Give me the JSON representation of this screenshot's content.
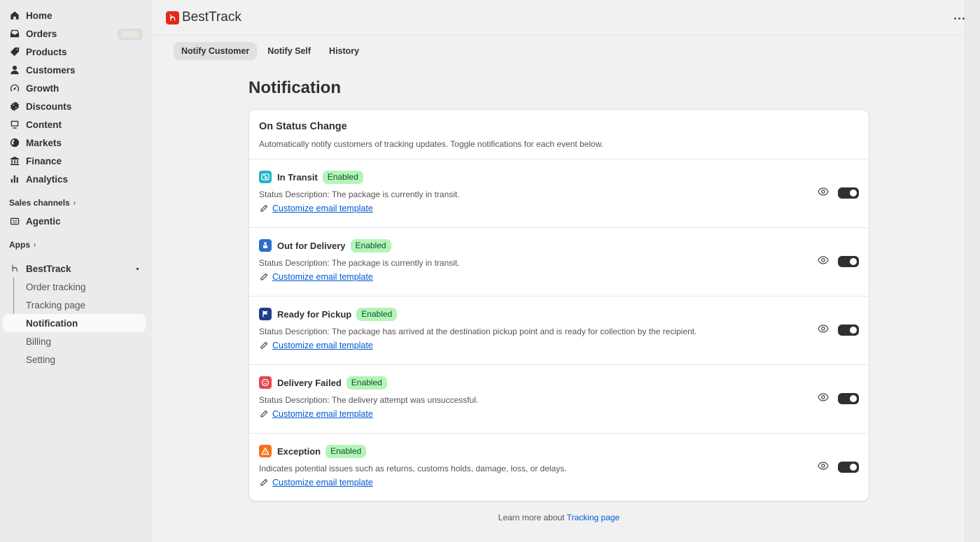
{
  "sidebar": {
    "items": [
      {
        "label": "Home",
        "icon": "home-icon"
      },
      {
        "label": "Orders",
        "icon": "orders-icon"
      },
      {
        "label": "Products",
        "icon": "tag-icon"
      },
      {
        "label": "Customers",
        "icon": "person-icon"
      },
      {
        "label": "Growth",
        "icon": "gauge-icon"
      },
      {
        "label": "Discounts",
        "icon": "discount-icon"
      },
      {
        "label": "Content",
        "icon": "image-icon"
      },
      {
        "label": "Markets",
        "icon": "globe-icon"
      },
      {
        "label": "Finance",
        "icon": "bank-icon"
      },
      {
        "label": "Analytics",
        "icon": "bar-chart-icon"
      }
    ],
    "sales_channels_label": "Sales channels",
    "agentic_label": "Agentic",
    "apps_label": "Apps",
    "app_name": "BestTrack",
    "app_subitems": [
      "Order tracking",
      "Tracking page",
      "Notification",
      "Billing",
      "Setting"
    ]
  },
  "header": {
    "app_title": "BestTrack"
  },
  "tabs": [
    {
      "label": "Notify Customer",
      "active": true
    },
    {
      "label": "Notify Self",
      "active": false
    },
    {
      "label": "History",
      "active": false
    }
  ],
  "page_title": "Notification",
  "card": {
    "title": "On Status Change",
    "subtitle": "Automatically notify customers of tracking updates. Toggle notifications for each event below.",
    "rows": [
      {
        "name": "In Transit",
        "badge": "Enabled",
        "description": "Status Description: The package is currently in transit.",
        "link": "Customize email template",
        "color": "#1fb6c8",
        "icon": "truck-icon"
      },
      {
        "name": "Out for Delivery",
        "badge": "Enabled",
        "description": "Status Description: The package is currently in transit.",
        "link": "Customize email template",
        "color": "#2c6ecb",
        "icon": "delivery-person-icon"
      },
      {
        "name": "Ready for Pickup",
        "badge": "Enabled",
        "description": "Status Description: The package has arrived at the destination pickup point and is ready for collection by the recipient.",
        "link": "Customize email template",
        "color": "#1f3f8a",
        "icon": "flag-icon"
      },
      {
        "name": "Delivery Failed",
        "badge": "Enabled",
        "description": "Status Description: The delivery attempt was unsuccessful.",
        "link": "Customize email template",
        "color": "#e5484d",
        "icon": "sad-face-icon"
      },
      {
        "name": "Exception",
        "badge": "Enabled",
        "description": "Indicates potential issues such as returns, customs holds, damage, loss, or delays.",
        "link": "Customize email template",
        "color": "#f5721b",
        "icon": "warning-icon"
      }
    ]
  },
  "footer": {
    "text": "Learn more about ",
    "link": "Tracking page"
  }
}
